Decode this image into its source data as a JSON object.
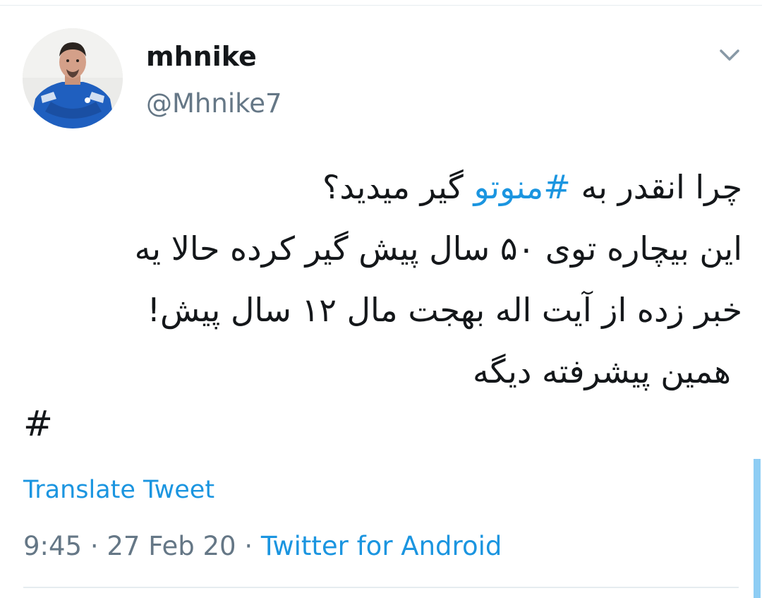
{
  "tweet": {
    "display_name": "mhnike",
    "handle": "@Mhnike7",
    "avatar_icon": "profile-photo",
    "lines": [
      {
        "before": "چرا انقدر به ",
        "hashtag": "#منوتو",
        "after": " گیر میدید؟"
      },
      {
        "text": "این بیچاره توی ۵۰ سال پیش گیر کرده حالا یه"
      },
      {
        "text": "خبر زده از آیت اله بهجت مال ۱۲ سال پیش!"
      },
      {
        "text": "همین پیشرفته دیگه"
      }
    ],
    "trailing_hashtag": "#",
    "translate_label": "Translate Tweet",
    "time": "9:45",
    "date": "27 Feb 20",
    "separator": " · ",
    "source": "Twitter for Android"
  },
  "colors": {
    "link": "#1b95e0",
    "secondary_text": "#657786",
    "primary_text": "#14171a",
    "divider": "#e6ecf0",
    "scrollbar": "#8ecdf4"
  }
}
